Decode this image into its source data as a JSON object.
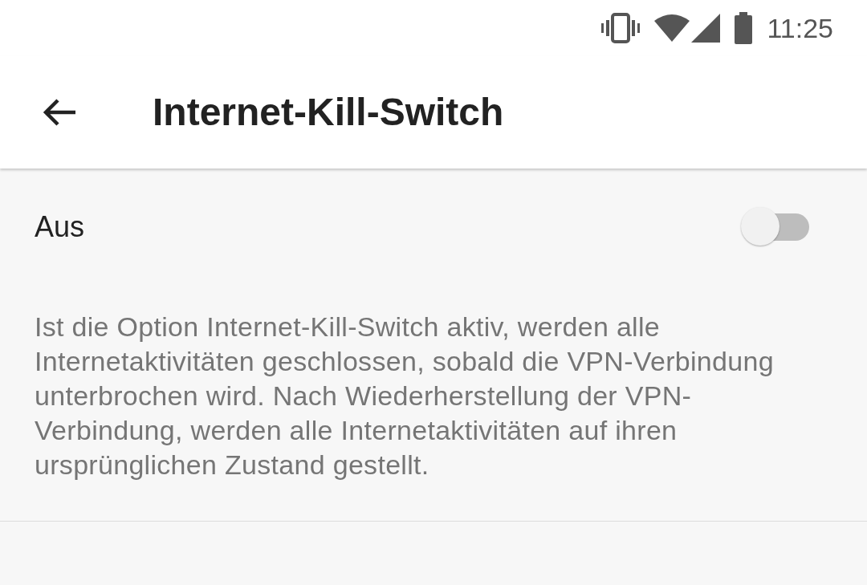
{
  "status_bar": {
    "time": "11:25"
  },
  "app_bar": {
    "title": "Internet-Kill-Switch"
  },
  "setting": {
    "label": "Aus",
    "on": false
  },
  "description": "Ist die Option Internet-Kill-Switch aktiv, werden alle Internetaktivitäten geschlossen, sobald die VPN-Verbindung unterbrochen wird. Nach Wiederherstellung der VPN-Verbindung, werden alle Internetaktivitäten auf ihren ursprünglichen Zustand gestellt."
}
